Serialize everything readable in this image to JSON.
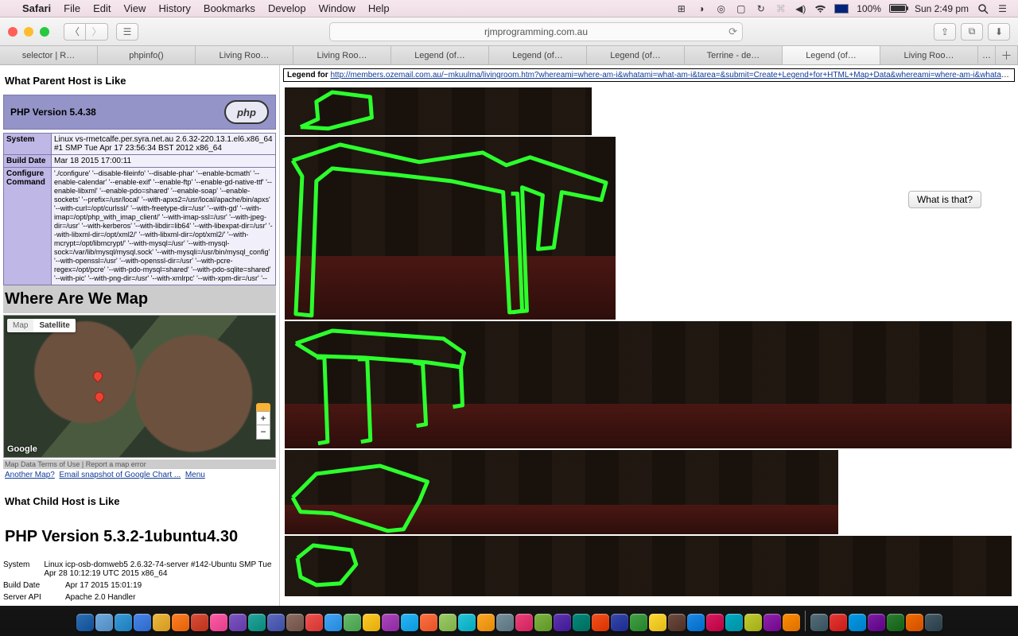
{
  "menubar": {
    "app": "Safari",
    "items": [
      "File",
      "Edit",
      "View",
      "History",
      "Bookmarks",
      "Develop",
      "Window",
      "Help"
    ],
    "battery_pct": "100%",
    "clock": "Sun 2:49 pm"
  },
  "safari": {
    "address": "rjmprogramming.com.au",
    "tabs": [
      "selector | R…",
      "phpinfo()",
      "Living Roo…",
      "Living Roo…",
      "Legend (of…",
      "Legend (of…",
      "Legend (of…",
      "Terrine - de…",
      "Legend (of…",
      "Living Roo…"
    ],
    "active_tab_index": 8
  },
  "left": {
    "parent_heading": "What Parent Host is Like",
    "php_version_label": "PHP Version 5.4.38",
    "php_logo_text": "php",
    "phpinfo_rows": [
      {
        "k": "System",
        "v": "Linux vs-rmetcalfe.per.syra.net.au 2.6.32-220.13.1.el6.x86_64 #1 SMP Tue Apr 17 23:56:34 BST 2012 x86_64"
      },
      {
        "k": "Build Date",
        "v": "Mar 18 2015 17:00:11"
      },
      {
        "k": "Configure Command",
        "v": "'./configure' '--disable-fileinfo' '--disable-phar' '--enable-bcmath' '--enable-calendar' '--enable-exif' '--enable-ftp' '--enable-gd-native-ttf' '--enable-libxml' '--enable-pdo=shared' '--enable-soap' '--enable-sockets' '--prefix=/usr/local' '--with-apxs2=/usr/local/apache/bin/apxs' '--with-curl=/opt/curlssl/' '--with-freetype-dir=/usr' '--with-gd' '--with-imap=/opt/php_with_imap_client/' '--with-imap-ssl=/usr' '--with-jpeg-dir=/usr' '--with-kerberos' '--with-libdir=lib64' '--with-libexpat-dir=/usr' '--with-libxml-dir=/opt/xml2/' '--with-libxml-dir=/opt/xml2/' '--with-mcrypt=/opt/libmcrypt/' '--with-mysql=/usr' '--with-mysql-sock=/var/lib/mysql/mysql.sock' '--with-mysqli=/usr/bin/mysql_config' '--with-openssl=/usr' '--with-openssl-dir=/usr' '--with-pcre-regex=/opt/pcre' '--with-pdo-mysql=shared' '--with-pdo-sqlite=shared' '--with-pic' '--with-png-dir=/usr' '--with-xmlrpc' '--with-xpm-dir=/usr' '--"
      }
    ],
    "where_heading": "Where Are We Map",
    "map": {
      "type_map": "Map",
      "type_sat": "Satellite",
      "google": "Google",
      "footer": "Map Data   Terms of Use | Report a map error",
      "links_prefix": "Another Map?",
      "links_mid": "Email snapshot of Google Chart ...",
      "links_menu": "Menu"
    },
    "child_heading": "What Child Host is Like",
    "child_title": "PHP Version 5.3.2-1ubuntu4.30",
    "child_rows": [
      {
        "k": "System",
        "v": "Linux icp-osb-domweb5 2.6.32-74-server #142-Ubuntu SMP Tue Apr 28 10:12:19 UTC 2015 x86_64"
      },
      {
        "k": "Build Date",
        "v": "Apr 17 2015 15:01:19"
      },
      {
        "k": "Server API",
        "v": "Apache 2.0 Handler"
      }
    ]
  },
  "right": {
    "legend_label": "Legend for ",
    "legend_url": "http://members.ozemail.com.au/~mkuulma/livingroom.htm?whereami=where-am-i&whatami=what-am-i&tarea=&submit=Create+Legend+for+HTML+Map+Data&whereami=where-am-i&whatami=what-am-i",
    "what_button": "What is that?"
  },
  "dock_colors": [
    "#2f6db3",
    "#6fa8dc",
    "#3a9bd8",
    "#4a86e8",
    "#efb73e",
    "#ff7f27",
    "#d94f3a",
    "#ff5ca8",
    "#7e57c2",
    "#26a69a",
    "#5c6bc0",
    "#8d6e63",
    "#ef5350",
    "#42a5f5",
    "#66bb6a",
    "#ffca28",
    "#ab47bc",
    "#29b6f6",
    "#ff7043",
    "#9ccc65",
    "#26c6da",
    "#ffa726",
    "#78909c",
    "#ec407a",
    "#7cb342",
    "#5e35b1",
    "#00897b",
    "#f4511e",
    "#3949ab",
    "#43a047",
    "#fdd835",
    "#6d4c41",
    "#1e88e5",
    "#d81b60",
    "#00acc1",
    "#c0ca33",
    "#8e24aa",
    "#fb8c00",
    "#546e7a",
    "#e53935",
    "#039be5",
    "#7b1fa2",
    "#2e7d32",
    "#ef6c00",
    "#455a64"
  ]
}
